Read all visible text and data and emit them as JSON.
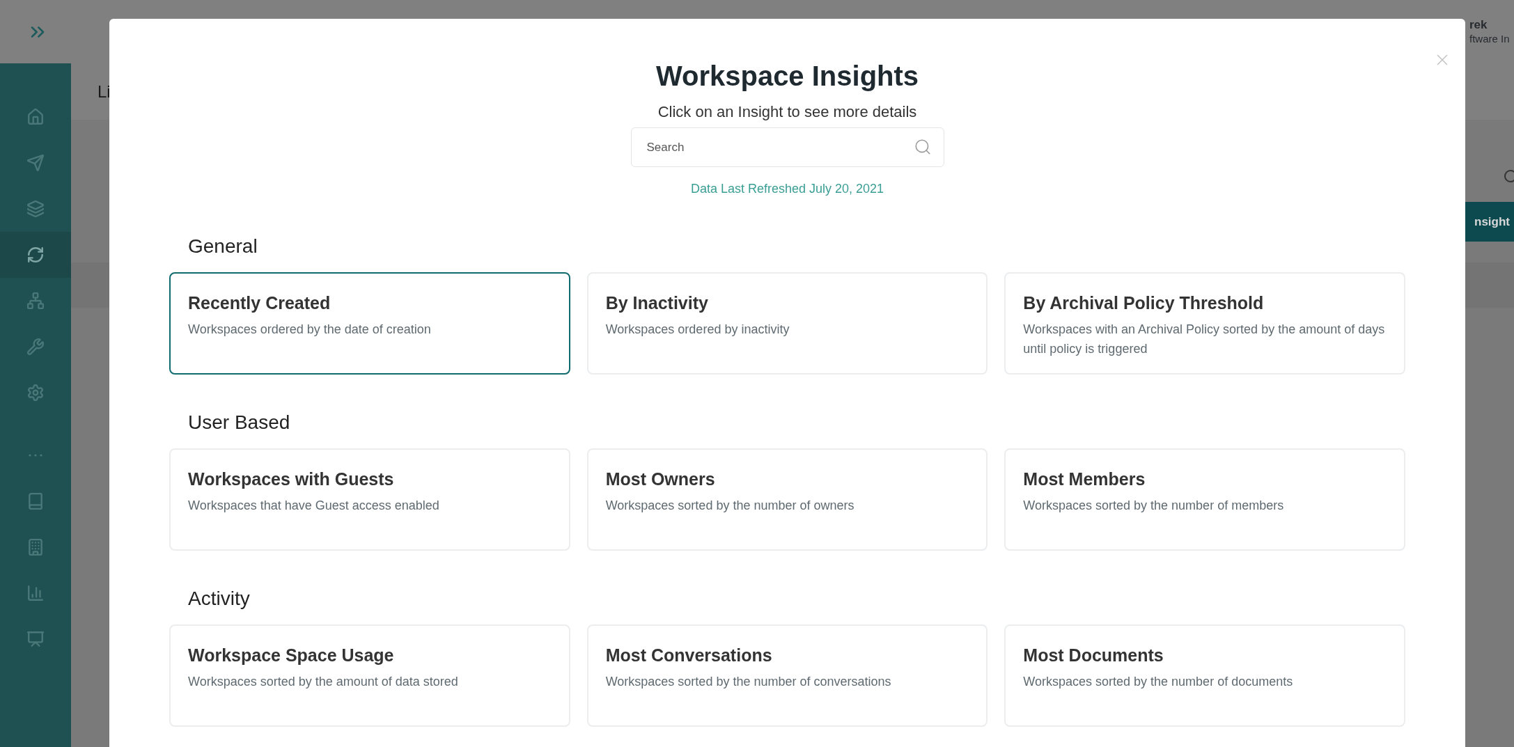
{
  "background": {
    "breadcrumb": "Li",
    "user_name": "rek",
    "user_role": "ftware In",
    "button": "nsight",
    "nav": [
      {
        "kind": "home",
        "selected": false
      },
      {
        "kind": "send",
        "selected": false
      },
      {
        "kind": "layers",
        "selected": false
      },
      {
        "kind": "sync",
        "selected": true
      },
      {
        "kind": "hierarchy",
        "selected": false
      },
      {
        "kind": "tools",
        "selected": false
      },
      {
        "kind": "gear",
        "selected": false
      },
      {
        "kind": "more",
        "selected": false
      },
      {
        "kind": "book",
        "selected": false
      },
      {
        "kind": "building",
        "selected": false
      },
      {
        "kind": "chart",
        "selected": false
      },
      {
        "kind": "presenter",
        "selected": false
      }
    ]
  },
  "modal": {
    "title": "Workspace Insights",
    "subtitle": "Click on an Insight to see more details",
    "search": {
      "placeholder": "Search"
    },
    "refreshed": "Data Last Refreshed July 20, 2021",
    "sections": [
      {
        "heading": "General",
        "cards": [
          {
            "title": "Recently Created",
            "description": "Workspaces ordered by the date of creation",
            "selected": true
          },
          {
            "title": "By Inactivity",
            "description": "Workspaces ordered by inactivity",
            "selected": false
          },
          {
            "title": "By Archival Policy Threshold",
            "description": "Workspaces with an Archival Policy sorted by the amount of days until policy is triggered",
            "selected": false
          }
        ]
      },
      {
        "heading": "User Based",
        "cards": [
          {
            "title": "Workspaces with Guests",
            "description": "Workspaces that have Guest access enabled",
            "selected": false
          },
          {
            "title": "Most Owners",
            "description": "Workspaces sorted by the number of owners",
            "selected": false
          },
          {
            "title": "Most Members",
            "description": "Workspaces sorted by the number of members",
            "selected": false
          }
        ]
      },
      {
        "heading": "Activity",
        "cards": [
          {
            "title": "Workspace Space Usage",
            "description": "Workspaces sorted by the amount of data stored",
            "selected": false
          },
          {
            "title": "Most Conversations",
            "description": "Workspaces sorted by the number of conversations",
            "selected": false
          },
          {
            "title": "Most Documents",
            "description": "Workspaces sorted by the number of documents",
            "selected": false
          }
        ]
      }
    ]
  }
}
